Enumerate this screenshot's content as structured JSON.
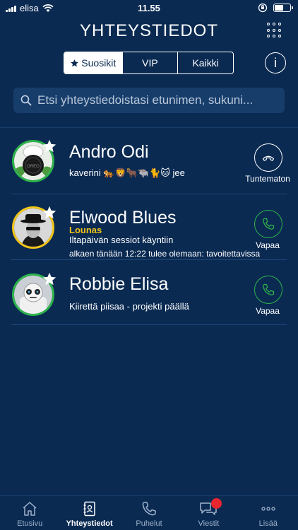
{
  "status_bar": {
    "carrier": "elisa",
    "time": "11.55"
  },
  "header": {
    "title": "YHTEYSTIEDOT"
  },
  "segments": [
    {
      "label": "Suosikit",
      "icon": "star-icon",
      "active": true
    },
    {
      "label": "VIP",
      "active": false
    },
    {
      "label": "Kaikki",
      "active": false
    }
  ],
  "info_button": {
    "label": "i"
  },
  "search": {
    "placeholder": "Etsi yhteystiedoistasi etunimen, sukuni..."
  },
  "contacts": [
    {
      "name": "Andro Odi",
      "status": "kaverini 🐅🦁🐂🐃🐈🐱 jee",
      "call_state": "Tuntematon",
      "call_color": "#ffffff",
      "ring_color": "#2db34a"
    },
    {
      "name": "Elwood Blues",
      "presence": "Lounas",
      "status": "Iltapäivän sessiot käyntiin",
      "detail": "alkaen tänään 12:22 tulee olemaan: tavoitettavissa",
      "call_state": "Vapaa",
      "call_color": "#2db34a",
      "ring_color": "#f2c417"
    },
    {
      "name": "Robbie Elisa",
      "status": "Kiirettä piisaa - projekti päällä",
      "call_state": "Vapaa",
      "call_color": "#2db34a",
      "ring_color": "#2db34a"
    }
  ],
  "tabbar": [
    {
      "label": "Etusivu",
      "icon": "home-icon",
      "active": false
    },
    {
      "label": "Yhteystiedot",
      "icon": "contacts-book-icon",
      "active": true
    },
    {
      "label": "Puhelut",
      "icon": "phone-icon",
      "active": false
    },
    {
      "label": "Viestit",
      "icon": "chat-bubbles-icon",
      "active": false,
      "badge": true
    },
    {
      "label": "Lisää",
      "icon": "more-dots-icon",
      "active": false
    }
  ],
  "colors": {
    "background": "#0a2a52",
    "search_bg": "#173d6b",
    "available": "#2db34a",
    "presence_yellow": "#f2c417",
    "badge_red": "#e8262e"
  }
}
